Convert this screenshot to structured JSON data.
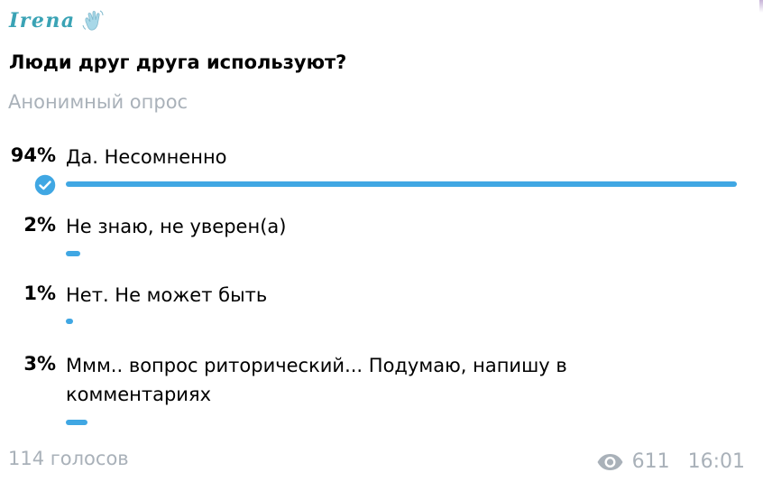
{
  "author": {
    "name": "Irena",
    "emoji_icon": "waving-hand-icon"
  },
  "poll": {
    "question": "Люди друг друга используют?",
    "type_label": "Анонимный опрос",
    "options": [
      {
        "percent_label": "94%",
        "label": "Да. Несомненно",
        "percent": 94,
        "chosen": true
      },
      {
        "percent_label": "2%",
        "label": "Не знаю, не уверен(а)",
        "percent": 2,
        "chosen": false
      },
      {
        "percent_label": "1%",
        "label": "Нет. Не может быть",
        "percent": 1,
        "chosen": false
      },
      {
        "percent_label": "3%",
        "label": "Ммм.. вопрос риторический... Подумаю, напишу в комментариях",
        "percent": 3,
        "chosen": false
      }
    ]
  },
  "footer": {
    "votes": "114 голосов",
    "views": "611",
    "time": "16:01"
  },
  "colors": {
    "accent": "#40a7e3",
    "muted": "#a9b1b9",
    "author": "#3aa3b5"
  }
}
